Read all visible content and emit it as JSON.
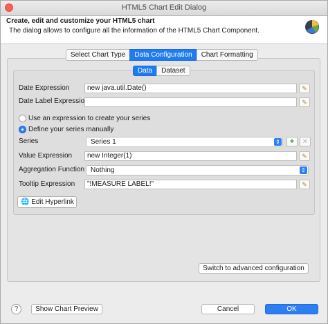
{
  "window": {
    "title": "HTML5 Chart Edit Dialog"
  },
  "header": {
    "heading": "Create, edit and customize your HTML5 chart",
    "description": "The dialog allows to configure all the information of the HTML5 Chart Component."
  },
  "main_tabs": [
    {
      "label": "Select Chart Type",
      "active": false
    },
    {
      "label": "Data Configuration",
      "active": true
    },
    {
      "label": "Chart Formatting",
      "active": false
    }
  ],
  "sub_tabs": [
    {
      "label": "Data",
      "active": true
    },
    {
      "label": "Dataset",
      "active": false
    }
  ],
  "form": {
    "date_expression": {
      "label": "Date Expression",
      "value": "new java.util.Date()"
    },
    "date_label_expression": {
      "label": "Date Label Expression",
      "value": ""
    },
    "radio_expression": {
      "label": "Use an expression to create your series",
      "selected": false
    },
    "radio_manual": {
      "label": "Define your series manually",
      "selected": true
    },
    "series": {
      "label": "Series",
      "value": "Series 1"
    },
    "value_expression": {
      "label": "Value Expression",
      "value": "new Integer(1)"
    },
    "aggregation_function": {
      "label": "Aggregation Function",
      "value": "Nothing"
    },
    "tooltip_expression": {
      "label": "Tooltip Expression",
      "value": "\"!MEASURE LABEL!\""
    },
    "edit_hyperlink": "Edit Hyperlink"
  },
  "buttons": {
    "advanced": "Switch to advanced configuration",
    "preview": "Show Chart Preview",
    "cancel": "Cancel",
    "ok": "OK",
    "help": "?"
  },
  "colors": {
    "accent": "#2d7ef2",
    "close": "#fc5f57"
  },
  "icons": {
    "expression_editor": "pencil-icon",
    "add_series": "plus-icon",
    "remove_series": "close-icon",
    "hyperlink": "globe-icon"
  }
}
